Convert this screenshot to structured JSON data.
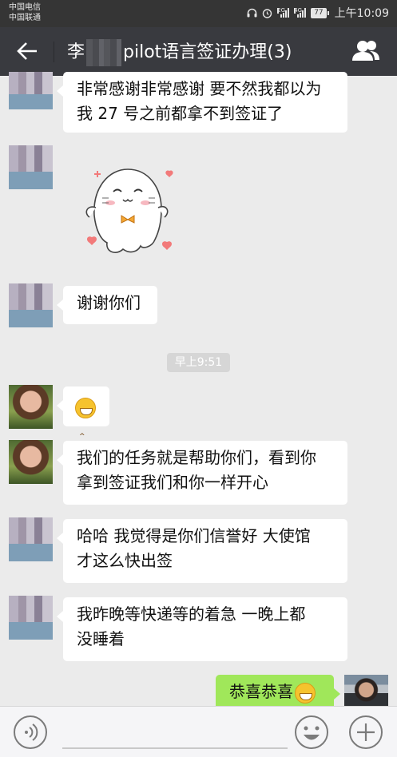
{
  "status_bar": {
    "carrier_1": "中国电信",
    "carrier_2": "中国联通",
    "network_1": "2G",
    "network_2": "4G",
    "battery": "77",
    "time": "上午10:09"
  },
  "header": {
    "name_prefix": "李",
    "title_suffix": "pilot语言签证办理(3)",
    "back_icon": "back-arrow-icon",
    "group_icon": "group-members-icon"
  },
  "messages": [
    {
      "side": "left",
      "text_line1": "非常感谢非常感谢 要不然我都以为",
      "text_line2": "我 27 号之前都拿不到签证了"
    },
    {
      "side": "left",
      "sticker": "cute-seal-sticker"
    },
    {
      "side": "left",
      "text": "谢谢你们"
    },
    {
      "timestamp": "早上9:51"
    },
    {
      "side": "left",
      "emoji": "grinning-emoji"
    },
    {
      "side": "left",
      "text_line1": "我们的任务就是帮助你们，看到你",
      "text_line2": "拿到签证我们和你一样开心"
    },
    {
      "side": "left",
      "text_line1": "哈哈  我觉得是你们信誉好  大使馆",
      "text_line2": "才这么快出签"
    },
    {
      "side": "left",
      "text_line1": "我昨晚等快递等的着急  一晚上都",
      "text_line2": "没睡着"
    },
    {
      "side": "right",
      "text": "恭喜恭喜",
      "emoji": "grinning-emoji"
    }
  ],
  "input_bar": {
    "voice_icon": "voice-input-icon",
    "emoji_icon": "emoji-icon",
    "plus_icon": "plus-icon"
  },
  "colors": {
    "title_bar": "#393a3f",
    "status_bar": "#353535",
    "background": "#ebebeb",
    "outgoing_bubble": "#a0e75a",
    "incoming_bubble": "#ffffff"
  }
}
